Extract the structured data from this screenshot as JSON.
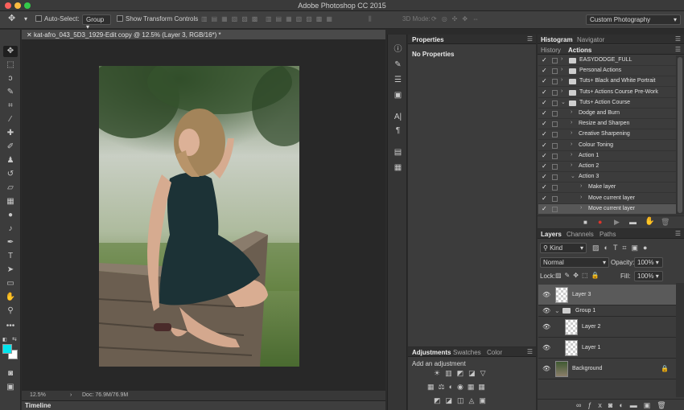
{
  "app_title": "Adobe Photoshop CC 2015",
  "window_controls": {
    "close_color": "#fc605c",
    "minimize_color": "#fdbc40",
    "zoom_color": "#34c84a"
  },
  "options_bar": {
    "auto_select_label": "Auto-Select:",
    "auto_select_value": "Group",
    "transform_label": "Show Transform Controls",
    "mode_3d_label": "3D Mode:",
    "workspace": "Custom Photography"
  },
  "document": {
    "tab_title": "kat-afro_043_5D3_1929-Edit copy @ 12.5% (Layer 3, RGB/16*) *",
    "zoom": "12.5%",
    "doc_size": "Doc: 76.9M/76.9M"
  },
  "timeline_label": "Timeline",
  "properties": {
    "tab": "Properties",
    "body": "No Properties"
  },
  "adjustments": {
    "tabs": [
      "Adjustments",
      "Swatches",
      "Color"
    ],
    "hint": "Add an adjustment"
  },
  "top_right_tabs": {
    "row1": [
      "Histogram",
      "Navigator"
    ],
    "row2": [
      "History",
      "Actions"
    ]
  },
  "actions": [
    {
      "name": "EASYDODGE_FULL",
      "kind": "set",
      "level": 0,
      "checked": true,
      "dialog": false,
      "expanded": false
    },
    {
      "name": "Personal Actions",
      "kind": "set",
      "level": 0,
      "checked": true,
      "dialog": true,
      "expanded": false
    },
    {
      "name": "Tuts+ Black and White Portrait",
      "kind": "set",
      "level": 0,
      "checked": true,
      "dialog": true,
      "expanded": false
    },
    {
      "name": "Tuts+ Actions Course Pre-Work",
      "kind": "set",
      "level": 0,
      "checked": true,
      "dialog": true,
      "expanded": false
    },
    {
      "name": "Tuts+ Action Course",
      "kind": "set",
      "level": 0,
      "checked": true,
      "dialog": true,
      "expanded": true
    },
    {
      "name": "Dodge and Burn",
      "kind": "action",
      "level": 1,
      "checked": true,
      "dialog": false,
      "expanded": false
    },
    {
      "name": "Resize and Sharpen",
      "kind": "action",
      "level": 1,
      "checked": true,
      "dialog": true,
      "expanded": false
    },
    {
      "name": "Creative Sharpening",
      "kind": "action",
      "level": 1,
      "checked": true,
      "dialog": true,
      "expanded": false
    },
    {
      "name": "Colour Toning",
      "kind": "action",
      "level": 1,
      "checked": true,
      "dialog": false,
      "expanded": false
    },
    {
      "name": "Action 1",
      "kind": "action",
      "level": 1,
      "checked": true,
      "dialog": false,
      "expanded": false
    },
    {
      "name": "Action 2",
      "kind": "action",
      "level": 1,
      "checked": true,
      "dialog": false,
      "expanded": false
    },
    {
      "name": "Action 3",
      "kind": "action",
      "level": 1,
      "checked": true,
      "dialog": false,
      "expanded": true
    },
    {
      "name": "Make layer",
      "kind": "step",
      "level": 2,
      "checked": true,
      "dialog": false,
      "expanded": false
    },
    {
      "name": "Move current layer",
      "kind": "step",
      "level": 2,
      "checked": true,
      "dialog": false,
      "expanded": false
    },
    {
      "name": "Move current layer",
      "kind": "step",
      "level": 2,
      "checked": true,
      "dialog": false,
      "expanded": false,
      "highlight": true
    }
  ],
  "layers_panel": {
    "tabs": [
      "Layers",
      "Channels",
      "Paths"
    ],
    "filter_kind": "Kind",
    "blend_mode": "Normal",
    "opacity_label": "Opacity:",
    "opacity_value": "100%",
    "lock_label": "Lock:",
    "fill_label": "Fill:",
    "fill_value": "100%",
    "layers": [
      {
        "name": "Layer 3",
        "type": "pixel",
        "selected": true,
        "indent": 0
      },
      {
        "name": "Group 1",
        "type": "group",
        "selected": false,
        "indent": 0
      },
      {
        "name": "Layer 2",
        "type": "pixel",
        "selected": false,
        "indent": 1
      },
      {
        "name": "Layer 1",
        "type": "pixel",
        "selected": false,
        "indent": 1
      },
      {
        "name": "Background",
        "type": "background",
        "selected": false,
        "indent": 0,
        "locked": true
      }
    ]
  },
  "colors": {
    "foreground": "#00e5ee",
    "background": "#ffffff"
  }
}
